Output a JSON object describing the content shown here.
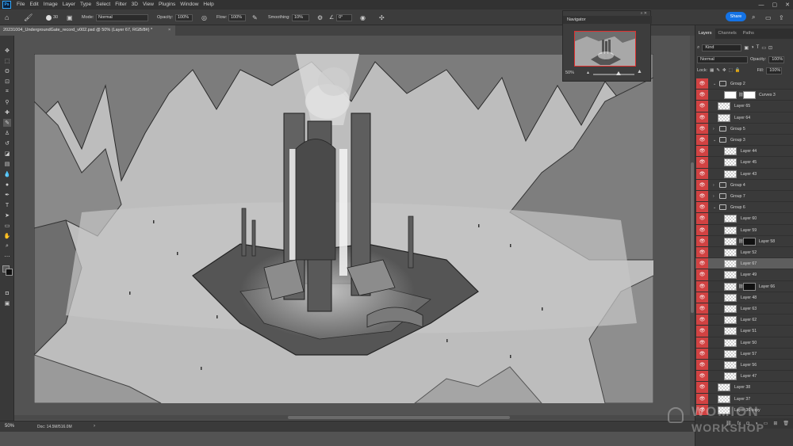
{
  "app": {
    "logo": "Ps",
    "menu": [
      "File",
      "Edit",
      "Image",
      "Layer",
      "Type",
      "Select",
      "Filter",
      "3D",
      "View",
      "Plugins",
      "Window",
      "Help"
    ],
    "window_controls": {
      "minimize": "—",
      "maximize": "▢",
      "close": "✕"
    }
  },
  "options": {
    "mode_label": "Mode:",
    "mode_value": "Normal",
    "opacity_label": "Opacity:",
    "opacity_value": "100%",
    "flow_label": "Flow:",
    "flow_value": "100%",
    "smoothing_label": "Smoothing:",
    "smoothing_value": "10%",
    "angle_value": "0°",
    "brush_size": "30"
  },
  "share_label": "Share",
  "document": {
    "tab_title": "20231004_UndergroundGate_record_v002.psd @ 50% (Layer 67, RGB/8#) *",
    "tab_close": "×"
  },
  "status": {
    "zoom": "50%",
    "doc_info": "Doc: 14.5M/516.0M"
  },
  "navigator": {
    "title": "Navigator",
    "zoom": "50%"
  },
  "layers_panel": {
    "tabs": [
      "Layers",
      "Channels",
      "Paths"
    ],
    "kind_label": "Kind",
    "blend_mode": "Normal",
    "opacity_label": "Opacity:",
    "opacity_value": "100%",
    "lock_label": "Lock:",
    "fill_label": "Fill:",
    "fill_value": "100%",
    "footer_icons": [
      "link-icon",
      "fx-icon",
      "mask-icon",
      "adjustment-icon",
      "folder-icon",
      "new-layer-icon",
      "trash-icon"
    ],
    "layers": [
      {
        "name": "Group 2",
        "type": "group",
        "expanded": true,
        "indent": 0
      },
      {
        "name": "Curves 3",
        "type": "adjustment",
        "indent": 1
      },
      {
        "name": "Layer 65",
        "type": "layer",
        "indent": 0
      },
      {
        "name": "Layer 64",
        "type": "layer",
        "indent": 0
      },
      {
        "name": "Group 5",
        "type": "group",
        "expanded": false,
        "indent": 0
      },
      {
        "name": "Group 3",
        "type": "group",
        "expanded": true,
        "indent": 0
      },
      {
        "name": "Layer 44",
        "type": "layer",
        "indent": 1
      },
      {
        "name": "Layer 45",
        "type": "layer",
        "indent": 1
      },
      {
        "name": "Layer 43",
        "type": "layer",
        "indent": 1
      },
      {
        "name": "Group 4",
        "type": "group",
        "expanded": false,
        "indent": 0
      },
      {
        "name": "Group 7",
        "type": "group",
        "expanded": false,
        "indent": 0
      },
      {
        "name": "Group 6",
        "type": "group",
        "expanded": true,
        "indent": 0
      },
      {
        "name": "Layer 60",
        "type": "layer",
        "indent": 1
      },
      {
        "name": "Layer 59",
        "type": "layer",
        "indent": 1
      },
      {
        "name": "Layer 58",
        "type": "masked",
        "indent": 1
      },
      {
        "name": "Layer 52",
        "type": "layer",
        "indent": 1
      },
      {
        "name": "Layer 67",
        "type": "layer",
        "indent": 1,
        "selected": true
      },
      {
        "name": "Layer 49",
        "type": "layer",
        "indent": 1
      },
      {
        "name": "Layer 66",
        "type": "masked",
        "indent": 1
      },
      {
        "name": "Layer 48",
        "type": "layer",
        "indent": 1
      },
      {
        "name": "Layer 63",
        "type": "layer",
        "indent": 1
      },
      {
        "name": "Layer 62",
        "type": "layer",
        "indent": 1
      },
      {
        "name": "Layer 51",
        "type": "layer",
        "indent": 1
      },
      {
        "name": "Layer 50",
        "type": "layer",
        "indent": 1
      },
      {
        "name": "Layer 57",
        "type": "layer",
        "indent": 1
      },
      {
        "name": "Layer 56",
        "type": "layer",
        "indent": 1
      },
      {
        "name": "Layer 47",
        "type": "layer",
        "indent": 1
      },
      {
        "name": "Layer 38",
        "type": "layer",
        "indent": 0
      },
      {
        "name": "Layer 37",
        "type": "layer",
        "indent": 0
      },
      {
        "name": "Layer 36 copy",
        "type": "layer",
        "indent": 0
      }
    ]
  },
  "watermark": {
    "line1": "WOMION",
    "line2": "WORKSHOP"
  }
}
